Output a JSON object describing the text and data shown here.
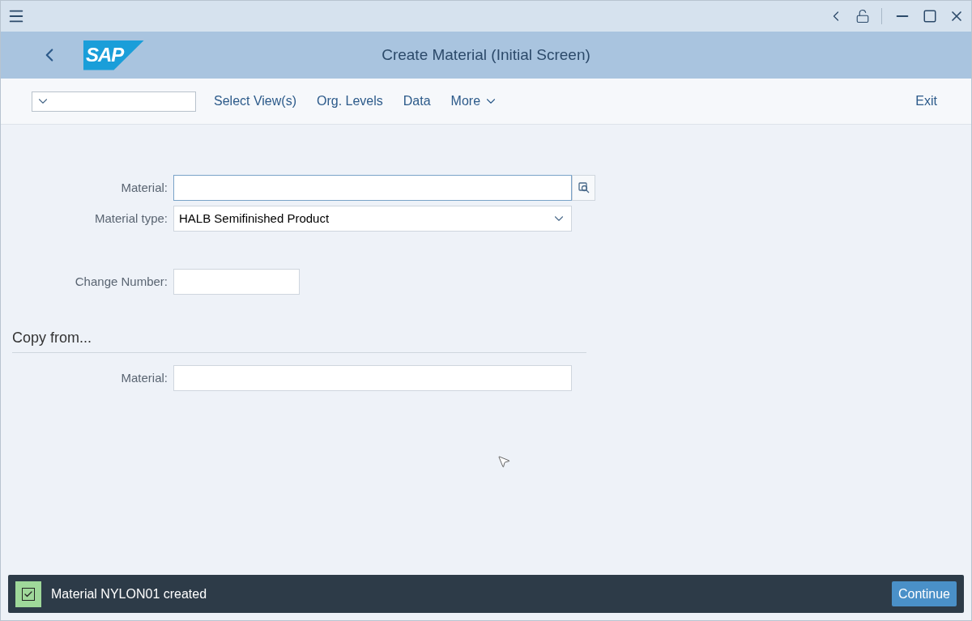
{
  "window": {
    "title": "Create Material (Initial Screen)",
    "logo": "SAP"
  },
  "toolbar": {
    "items": [
      {
        "label": "Select View(s)",
        "kind": "link"
      },
      {
        "label": "Org. Levels",
        "kind": "link"
      },
      {
        "label": "Data",
        "kind": "link"
      },
      {
        "label": "More",
        "kind": "menu"
      }
    ],
    "exit": "Exit"
  },
  "fields": [
    {
      "label": "Material:",
      "kind": "help",
      "focused": true
    },
    {
      "label": "Material type:",
      "value": "HALB Semifinished Product",
      "kind": "select",
      "focused": false
    },
    {
      "label": "Change Number:",
      "kind": "short",
      "focused": false
    }
  ],
  "copy_from": {
    "title": "Copy from...",
    "fields": [
      {
        "label": "Material:",
        "kind": "text",
        "focused": false
      }
    ]
  },
  "message": {
    "kind": "success",
    "text": "Material NYLON01 created",
    "button": "Continue"
  }
}
